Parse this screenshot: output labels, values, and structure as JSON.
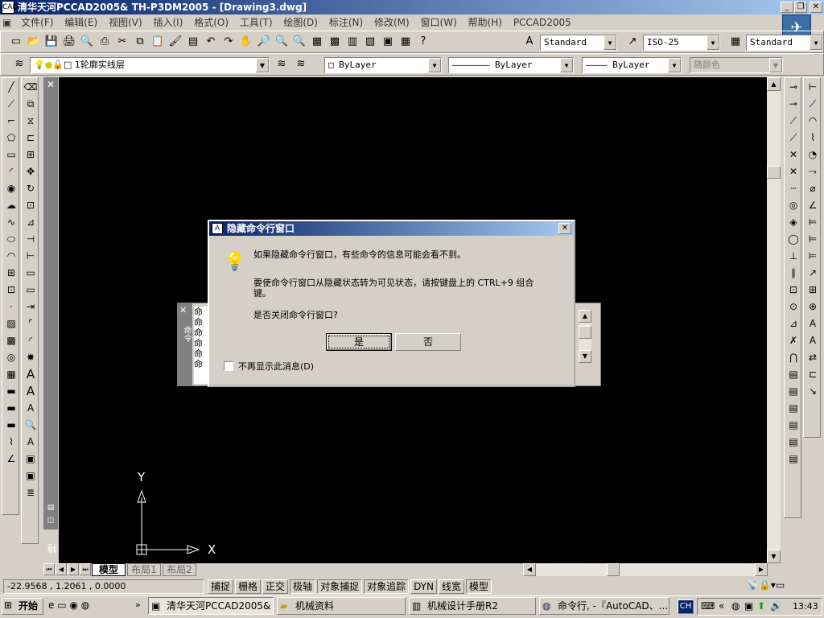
{
  "window": {
    "title": "清华天河PCCAD2005& TH-P3DM2005 - [Drawing3.dwg]",
    "icon": "app-icon"
  },
  "menu": [
    "文件(F)",
    "编辑(E)",
    "视图(V)",
    "插入(I)",
    "格式(O)",
    "工具(T)",
    "绘图(D)",
    "标注(N)",
    "修改(M)",
    "窗口(W)",
    "帮助(H)",
    "PCCAD2005"
  ],
  "toolbar": {
    "text_style": "Standard",
    "dim_style": "ISO-25",
    "table_style": "Standard",
    "layer": "1轮廓实线层",
    "color": "ByLayer",
    "linetype": "ByLayer",
    "lineweight": "ByLayer",
    "plotstyle": "随颜色"
  },
  "palette": {
    "properties_label": "特性",
    "cmd_label": "命令"
  },
  "cmd_window_lines": [
    "命",
    "命",
    "命",
    "命",
    "命",
    "命"
  ],
  "ucs": {
    "x": "X",
    "y": "Y"
  },
  "tabs": [
    "模型",
    "布局1",
    "布局2"
  ],
  "dialog": {
    "title": "隐藏命令行窗口",
    "message1": "如果隐藏命令行窗口，有些命令的信息可能会看不到。",
    "message2": "要使命令行窗口从隐藏状态转为可见状态，请按键盘上的 CTRL+9 组合键。",
    "question": "是否关闭命令行窗口?",
    "yes": "是",
    "no": "否",
    "checkbox": "不再显示此消息(D)"
  },
  "status": {
    "coords": "-22.9568 , 1.2061 , 0.0000",
    "buttons": [
      "捕捉",
      "栅格",
      "正交",
      "极轴",
      "对象捕捉",
      "对象追踪",
      "DYN",
      "线宽",
      "模型"
    ]
  },
  "taskbar": {
    "start": "开始",
    "tasks": [
      "清华天河PCCAD2005& ...",
      "机械资料",
      "机械设计手册R2",
      "命令行, -『AutoCAD、..."
    ],
    "lang": "CH",
    "time": "13:43"
  }
}
